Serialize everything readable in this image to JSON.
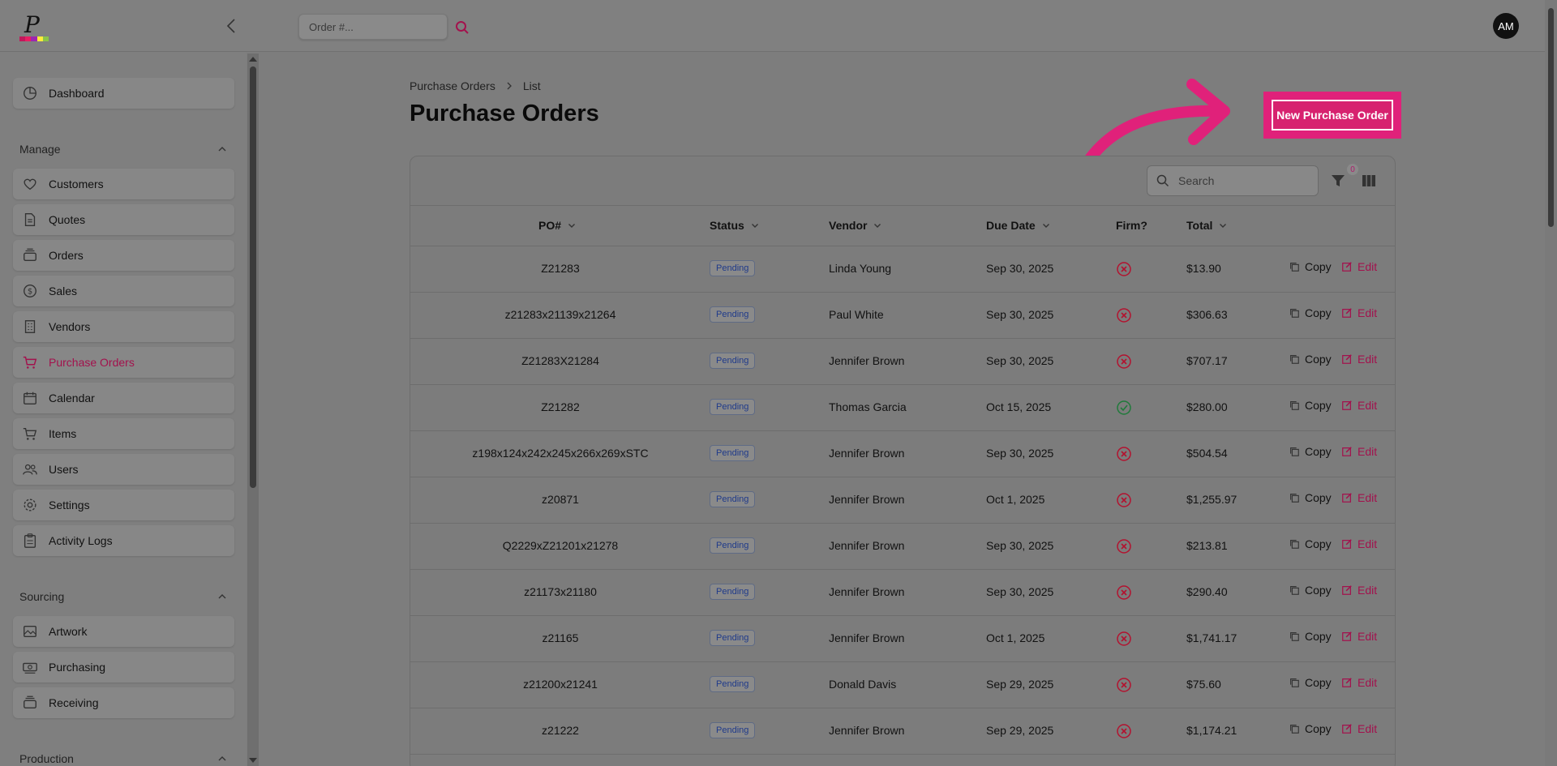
{
  "topbar": {
    "order_search_placeholder": "Order #...",
    "avatar_initials": "AM"
  },
  "logo": {
    "letter": "P",
    "colors": [
      "#c2185b",
      "#e91e63",
      "#9c27b0",
      "#ffeb3b",
      "#8bc34a"
    ]
  },
  "sidebar": {
    "dashboard": "Dashboard",
    "sections": [
      {
        "title": "Manage",
        "items": [
          "Customers",
          "Quotes",
          "Orders",
          "Sales",
          "Vendors",
          "Purchase Orders",
          "Calendar",
          "Items",
          "Users",
          "Settings",
          "Activity Logs"
        ]
      },
      {
        "title": "Sourcing",
        "items": [
          "Artwork",
          "Purchasing",
          "Receiving"
        ]
      },
      {
        "title": "Production",
        "items": []
      }
    ],
    "active": "Purchase Orders"
  },
  "breadcrumb": {
    "parent": "Purchase Orders",
    "current": "List"
  },
  "page_title": "Purchase Orders",
  "new_button": "New Purchase Order",
  "search_placeholder": "Search",
  "filter_count": "0",
  "columns": {
    "po": "PO#",
    "status": "Status",
    "vendor": "Vendor",
    "due": "Due Date",
    "firm": "Firm?",
    "total": "Total"
  },
  "actions": {
    "copy": "Copy",
    "edit": "Edit"
  },
  "rows": [
    {
      "po": "Z21283",
      "status": "Pending",
      "vendor": "Linda Young",
      "due": "Sep 30, 2025",
      "firm": false,
      "total": "$13.90"
    },
    {
      "po": "z21283x21139x21264",
      "status": "Pending",
      "vendor": "Paul White",
      "due": "Sep 30, 2025",
      "firm": false,
      "total": "$306.63"
    },
    {
      "po": "Z21283X21284",
      "status": "Pending",
      "vendor": "Jennifer Brown",
      "due": "Sep 30, 2025",
      "firm": false,
      "total": "$707.17"
    },
    {
      "po": "Z21282",
      "status": "Pending",
      "vendor": "Thomas Garcia",
      "due": "Oct 15, 2025",
      "firm": true,
      "total": "$280.00"
    },
    {
      "po": "z198x124x242x245x266x269xSTC",
      "status": "Pending",
      "vendor": "Jennifer Brown",
      "due": "Sep 30, 2025",
      "firm": false,
      "total": "$504.54"
    },
    {
      "po": "z20871",
      "status": "Pending",
      "vendor": "Jennifer Brown",
      "due": "Oct 1, 2025",
      "firm": false,
      "total": "$1,255.97"
    },
    {
      "po": "Q2229xZ21201x21278",
      "status": "Pending",
      "vendor": "Jennifer Brown",
      "due": "Sep 30, 2025",
      "firm": false,
      "total": "$213.81"
    },
    {
      "po": "z21173x21180",
      "status": "Pending",
      "vendor": "Jennifer Brown",
      "due": "Sep 30, 2025",
      "firm": false,
      "total": "$290.40"
    },
    {
      "po": "z21165",
      "status": "Pending",
      "vendor": "Jennifer Brown",
      "due": "Oct 1, 2025",
      "firm": false,
      "total": "$1,741.17"
    },
    {
      "po": "z21200x21241",
      "status": "Pending",
      "vendor": "Donald Davis",
      "due": "Sep 29, 2025",
      "firm": false,
      "total": "$75.60"
    },
    {
      "po": "z21222",
      "status": "Pending",
      "vendor": "Jennifer Brown",
      "due": "Sep 29, 2025",
      "firm": false,
      "total": "$1,174.21"
    }
  ],
  "colors": {
    "accent": "#e0217a",
    "active_nav": "#a3124d",
    "firm_no": "#b3122f",
    "firm_yes": "#1f7a3a"
  }
}
